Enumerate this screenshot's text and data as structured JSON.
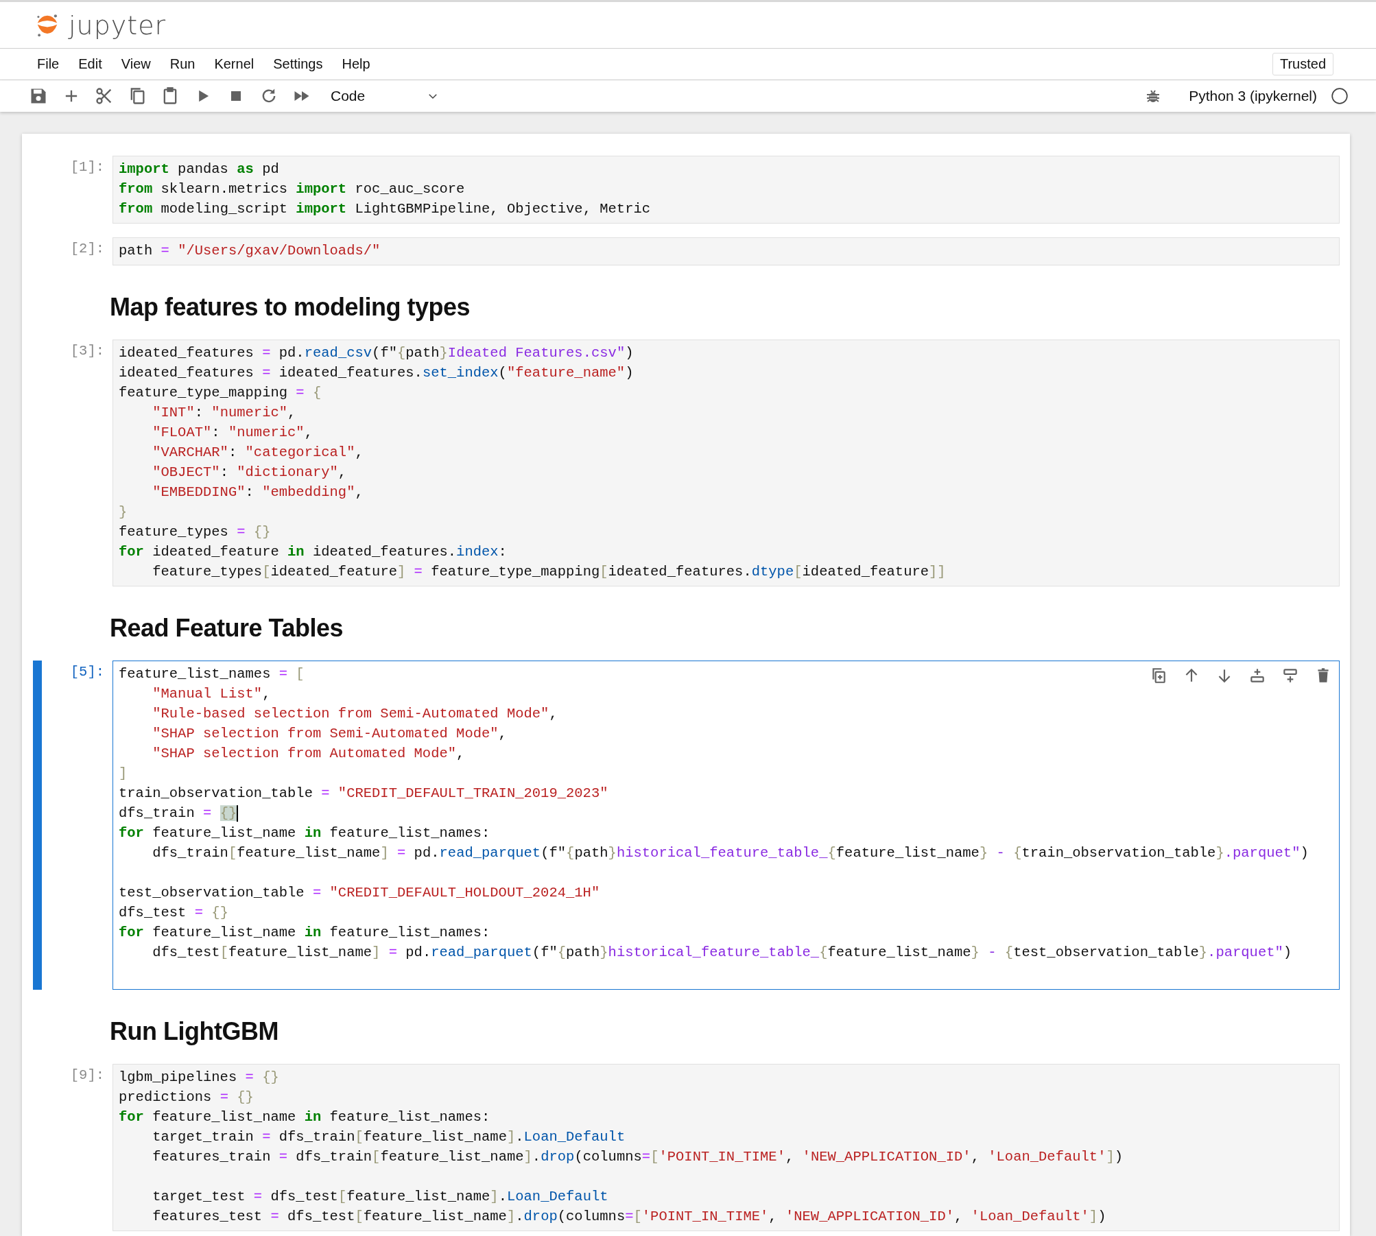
{
  "header": {
    "logo_text": "jupyter",
    "trusted_button": "Trusted"
  },
  "menu": [
    "File",
    "Edit",
    "View",
    "Run",
    "Kernel",
    "Settings",
    "Help"
  ],
  "toolbar": {
    "cell_type": "Code",
    "kernel_name": "Python 3 (ipykernel)"
  },
  "cells": [
    {
      "kind": "code",
      "prompt": "[1]:",
      "selected": false,
      "lines": [
        [
          {
            "kind": "kw",
            "text": "import"
          },
          {
            "kind": "tx",
            "text": " pandas "
          },
          {
            "kind": "kw",
            "text": "as"
          },
          {
            "kind": "tx",
            "text": " pd"
          }
        ],
        [
          {
            "kind": "kw",
            "text": "from"
          },
          {
            "kind": "tx",
            "text": " sklearn.metrics "
          },
          {
            "kind": "kw",
            "text": "import"
          },
          {
            "kind": "tx",
            "text": " roc_auc_score"
          }
        ],
        [
          {
            "kind": "kw",
            "text": "from"
          },
          {
            "kind": "tx",
            "text": " modeling_script "
          },
          {
            "kind": "kw",
            "text": "import"
          },
          {
            "kind": "tx",
            "text": " LightGBMPipeline, Objective, Metric"
          }
        ]
      ]
    },
    {
      "kind": "code",
      "prompt": "[2]:",
      "selected": false,
      "lines": [
        [
          {
            "kind": "tx",
            "text": "path "
          },
          {
            "kind": "op",
            "text": "= "
          },
          {
            "kind": "str",
            "text": "\"/Users/gxav/Downloads/\""
          }
        ]
      ]
    },
    {
      "kind": "markdown",
      "heading": "Map features to modeling types"
    },
    {
      "kind": "code",
      "prompt": "[3]:",
      "selected": false,
      "lines": [
        [
          {
            "kind": "tx",
            "text": "ideated_features "
          },
          {
            "kind": "op",
            "text": "="
          },
          {
            "kind": "tx",
            "text": " pd."
          },
          {
            "kind": "fn",
            "text": "read_csv"
          },
          {
            "kind": "tx",
            "text": "(f\""
          },
          {
            "kind": "br",
            "text": "{"
          },
          {
            "kind": "tx",
            "text": "path"
          },
          {
            "kind": "br",
            "text": "}"
          },
          {
            "kind": "fs",
            "text": "Ideated Features.csv\""
          },
          {
            "kind": "tx",
            "text": ")"
          }
        ],
        [
          {
            "kind": "tx",
            "text": "ideated_features "
          },
          {
            "kind": "op",
            "text": "="
          },
          {
            "kind": "tx",
            "text": " ideated_features."
          },
          {
            "kind": "fn",
            "text": "set_index"
          },
          {
            "kind": "tx",
            "text": "("
          },
          {
            "kind": "str",
            "text": "\"feature_name\""
          },
          {
            "kind": "tx",
            "text": ")"
          }
        ],
        [
          {
            "kind": "tx",
            "text": "feature_type_mapping "
          },
          {
            "kind": "op",
            "text": "= "
          },
          {
            "kind": "br",
            "text": "{"
          }
        ],
        [
          {
            "kind": "str",
            "text": "    \"INT\""
          },
          {
            "kind": "tx",
            "text": ": "
          },
          {
            "kind": "str",
            "text": "\"numeric\""
          },
          {
            "kind": "tx",
            "text": ","
          }
        ],
        [
          {
            "kind": "str",
            "text": "    \"FLOAT\""
          },
          {
            "kind": "tx",
            "text": ": "
          },
          {
            "kind": "str",
            "text": "\"numeric\""
          },
          {
            "kind": "tx",
            "text": ","
          }
        ],
        [
          {
            "kind": "str",
            "text": "    \"VARCHAR\""
          },
          {
            "kind": "tx",
            "text": ": "
          },
          {
            "kind": "str",
            "text": "\"categorical\""
          },
          {
            "kind": "tx",
            "text": ","
          }
        ],
        [
          {
            "kind": "str",
            "text": "    \"OBJECT\""
          },
          {
            "kind": "tx",
            "text": ": "
          },
          {
            "kind": "str",
            "text": "\"dictionary\""
          },
          {
            "kind": "tx",
            "text": ","
          }
        ],
        [
          {
            "kind": "str",
            "text": "    \"EMBEDDING\""
          },
          {
            "kind": "tx",
            "text": ": "
          },
          {
            "kind": "str",
            "text": "\"embedding\""
          },
          {
            "kind": "tx",
            "text": ","
          }
        ],
        [
          {
            "kind": "br",
            "text": "}"
          }
        ],
        [
          {
            "kind": "tx",
            "text": "feature_types "
          },
          {
            "kind": "op",
            "text": "= "
          },
          {
            "kind": "br",
            "text": "{}"
          }
        ],
        [
          {
            "kind": "kw",
            "text": "for"
          },
          {
            "kind": "tx",
            "text": " ideated_feature "
          },
          {
            "kind": "kw",
            "text": "in"
          },
          {
            "kind": "tx",
            "text": " ideated_features."
          },
          {
            "kind": "fn",
            "text": "index"
          },
          {
            "kind": "tx",
            "text": ":"
          }
        ],
        [
          {
            "kind": "tx",
            "text": "    feature_types"
          },
          {
            "kind": "br",
            "text": "["
          },
          {
            "kind": "tx",
            "text": "ideated_feature"
          },
          {
            "kind": "br",
            "text": "] "
          },
          {
            "kind": "op",
            "text": "="
          },
          {
            "kind": "tx",
            "text": " feature_type_mapping"
          },
          {
            "kind": "br",
            "text": "["
          },
          {
            "kind": "tx",
            "text": "ideated_features."
          },
          {
            "kind": "fn",
            "text": "dtype"
          },
          {
            "kind": "br",
            "text": "["
          },
          {
            "kind": "tx",
            "text": "ideated_feature"
          },
          {
            "kind": "br",
            "text": "]]"
          }
        ]
      ]
    },
    {
      "kind": "markdown",
      "heading": "Read Feature Tables"
    },
    {
      "kind": "code",
      "prompt": "[5]:",
      "selected": true,
      "lines": [
        [
          {
            "kind": "tx",
            "text": "feature_list_names "
          },
          {
            "kind": "op",
            "text": "= "
          },
          {
            "kind": "br",
            "text": "["
          }
        ],
        [
          {
            "kind": "str",
            "text": "    \"Manual List\""
          },
          {
            "kind": "tx",
            "text": ","
          }
        ],
        [
          {
            "kind": "str",
            "text": "    \"Rule-based selection from Semi-Automated Mode\""
          },
          {
            "kind": "tx",
            "text": ","
          }
        ],
        [
          {
            "kind": "str",
            "text": "    \"SHAP selection from Semi-Automated Mode\""
          },
          {
            "kind": "tx",
            "text": ","
          }
        ],
        [
          {
            "kind": "str",
            "text": "    \"SHAP selection from Automated Mode\""
          },
          {
            "kind": "tx",
            "text": ","
          }
        ],
        [
          {
            "kind": "br",
            "text": "]"
          }
        ],
        [
          {
            "kind": "tx",
            "text": "train_observation_table "
          },
          {
            "kind": "op",
            "text": "= "
          },
          {
            "kind": "str",
            "text": "\"CREDIT_DEFAULT_TRAIN_2019_2023\""
          }
        ],
        [
          {
            "kind": "tx",
            "text": "dfs_train "
          },
          {
            "kind": "op",
            "text": "= "
          },
          {
            "kind": "match",
            "text": "{}"
          }
        ],
        [
          {
            "kind": "kw",
            "text": "for"
          },
          {
            "kind": "tx",
            "text": " feature_list_name "
          },
          {
            "kind": "kw",
            "text": "in"
          },
          {
            "kind": "tx",
            "text": " feature_list_names:"
          }
        ],
        [
          {
            "kind": "tx",
            "text": "    dfs_train"
          },
          {
            "kind": "br",
            "text": "["
          },
          {
            "kind": "tx",
            "text": "feature_list_name"
          },
          {
            "kind": "br",
            "text": "] "
          },
          {
            "kind": "op",
            "text": "="
          },
          {
            "kind": "tx",
            "text": " pd."
          },
          {
            "kind": "fn",
            "text": "read_parquet"
          },
          {
            "kind": "tx",
            "text": "(f\""
          },
          {
            "kind": "br",
            "text": "{"
          },
          {
            "kind": "tx",
            "text": "path"
          },
          {
            "kind": "br",
            "text": "}"
          },
          {
            "kind": "fs",
            "text": "historical_feature_table_"
          },
          {
            "kind": "br",
            "text": "{"
          },
          {
            "kind": "tx",
            "text": "feature_list_name"
          },
          {
            "kind": "br",
            "text": "}"
          },
          {
            "kind": "fs",
            "text": " - "
          },
          {
            "kind": "br",
            "text": "{"
          },
          {
            "kind": "tx",
            "text": "train_observation_table"
          },
          {
            "kind": "br",
            "text": "}"
          },
          {
            "kind": "fs",
            "text": ".parquet\""
          },
          {
            "kind": "tx",
            "text": ")"
          }
        ],
        [
          {
            "kind": "gap"
          },
          {
            "kind": "tx",
            "text": "test_observation_table "
          },
          {
            "kind": "op",
            "text": "= "
          },
          {
            "kind": "str",
            "text": "\"CREDIT_DEFAULT_HOLDOUT_2024_1H\""
          }
        ],
        [
          {
            "kind": "tx",
            "text": "dfs_test "
          },
          {
            "kind": "op",
            "text": "= "
          },
          {
            "kind": "br",
            "text": "{}"
          }
        ],
        [
          {
            "kind": "kw",
            "text": "for"
          },
          {
            "kind": "tx",
            "text": " feature_list_name "
          },
          {
            "kind": "kw",
            "text": "in"
          },
          {
            "kind": "tx",
            "text": " feature_list_names:"
          }
        ],
        [
          {
            "kind": "tx",
            "text": "    dfs_test"
          },
          {
            "kind": "br",
            "text": "["
          },
          {
            "kind": "tx",
            "text": "feature_list_name"
          },
          {
            "kind": "br",
            "text": "] "
          },
          {
            "kind": "op",
            "text": "="
          },
          {
            "kind": "tx",
            "text": " pd."
          },
          {
            "kind": "fn",
            "text": "read_parquet"
          },
          {
            "kind": "tx",
            "text": "(f\""
          },
          {
            "kind": "br",
            "text": "{"
          },
          {
            "kind": "tx",
            "text": "path"
          },
          {
            "kind": "br",
            "text": "}"
          },
          {
            "kind": "fs",
            "text": "historical_feature_table_"
          },
          {
            "kind": "br",
            "text": "{"
          },
          {
            "kind": "tx",
            "text": "feature_list_name"
          },
          {
            "kind": "br",
            "text": "}"
          },
          {
            "kind": "fs",
            "text": " - "
          },
          {
            "kind": "br",
            "text": "{"
          },
          {
            "kind": "tx",
            "text": "test_observation_table"
          },
          {
            "kind": "br",
            "text": "}"
          },
          {
            "kind": "fs",
            "text": ".parquet\""
          },
          {
            "kind": "tx",
            "text": ")"
          }
        ]
      ]
    },
    {
      "kind": "markdown",
      "heading": "Run LightGBM"
    },
    {
      "kind": "code",
      "prompt": "[9]:",
      "selected": false,
      "lines": [
        [
          {
            "kind": "tx",
            "text": "lgbm_pipelines "
          },
          {
            "kind": "op",
            "text": "= "
          },
          {
            "kind": "br",
            "text": "{}"
          }
        ],
        [
          {
            "kind": "tx",
            "text": "predictions "
          },
          {
            "kind": "op",
            "text": "= "
          },
          {
            "kind": "br",
            "text": "{}"
          }
        ],
        [
          {
            "kind": "kw",
            "text": "for"
          },
          {
            "kind": "tx",
            "text": " feature_list_name "
          },
          {
            "kind": "kw",
            "text": "in"
          },
          {
            "kind": "tx",
            "text": " feature_list_names:"
          }
        ],
        [
          {
            "kind": "tx",
            "text": "    target_train "
          },
          {
            "kind": "op",
            "text": "="
          },
          {
            "kind": "tx",
            "text": " dfs_train"
          },
          {
            "kind": "br",
            "text": "["
          },
          {
            "kind": "tx",
            "text": "feature_list_name"
          },
          {
            "kind": "br",
            "text": "]"
          },
          {
            "kind": "tx",
            "text": "."
          },
          {
            "kind": "fn",
            "text": "Loan_Default"
          }
        ],
        [
          {
            "kind": "tx",
            "text": "    features_train "
          },
          {
            "kind": "op",
            "text": "="
          },
          {
            "kind": "tx",
            "text": " dfs_train"
          },
          {
            "kind": "br",
            "text": "["
          },
          {
            "kind": "tx",
            "text": "feature_list_name"
          },
          {
            "kind": "br",
            "text": "]"
          },
          {
            "kind": "tx",
            "text": "."
          },
          {
            "kind": "fn",
            "text": "drop"
          },
          {
            "kind": "tx",
            "text": "(columns"
          },
          {
            "kind": "op",
            "text": "="
          },
          {
            "kind": "br",
            "text": "["
          },
          {
            "kind": "str",
            "text": "'POINT_IN_TIME'"
          },
          {
            "kind": "tx",
            "text": ", "
          },
          {
            "kind": "str",
            "text": "'NEW_APPLICATION_ID'"
          },
          {
            "kind": "tx",
            "text": ", "
          },
          {
            "kind": "str",
            "text": "'Loan_Default'"
          },
          {
            "kind": "br",
            "text": "]"
          },
          {
            "kind": "tx",
            "text": ")"
          }
        ],
        [
          {
            "kind": "gap"
          },
          {
            "kind": "tx",
            "text": "    target_test "
          },
          {
            "kind": "op",
            "text": "="
          },
          {
            "kind": "tx",
            "text": " dfs_test"
          },
          {
            "kind": "br",
            "text": "["
          },
          {
            "kind": "tx",
            "text": "feature_list_name"
          },
          {
            "kind": "br",
            "text": "]"
          },
          {
            "kind": "tx",
            "text": "."
          },
          {
            "kind": "fn",
            "text": "Loan_Default"
          }
        ],
        [
          {
            "kind": "tx",
            "text": "    features_test "
          },
          {
            "kind": "op",
            "text": "="
          },
          {
            "kind": "tx",
            "text": " dfs_test"
          },
          {
            "kind": "br",
            "text": "["
          },
          {
            "kind": "tx",
            "text": "feature_list_name"
          },
          {
            "kind": "br",
            "text": "]"
          },
          {
            "kind": "tx",
            "text": "."
          },
          {
            "kind": "fn",
            "text": "drop"
          },
          {
            "kind": "tx",
            "text": "(columns"
          },
          {
            "kind": "op",
            "text": "="
          },
          {
            "kind": "br",
            "text": "["
          },
          {
            "kind": "str",
            "text": "'POINT_IN_TIME'"
          },
          {
            "kind": "tx",
            "text": ", "
          },
          {
            "kind": "str",
            "text": "'NEW_APPLICATION_ID'"
          },
          {
            "kind": "tx",
            "text": ", "
          },
          {
            "kind": "str",
            "text": "'Loan_Default'"
          },
          {
            "kind": "br",
            "text": "]"
          },
          {
            "kind": "tx",
            "text": ")"
          }
        ]
      ]
    }
  ]
}
